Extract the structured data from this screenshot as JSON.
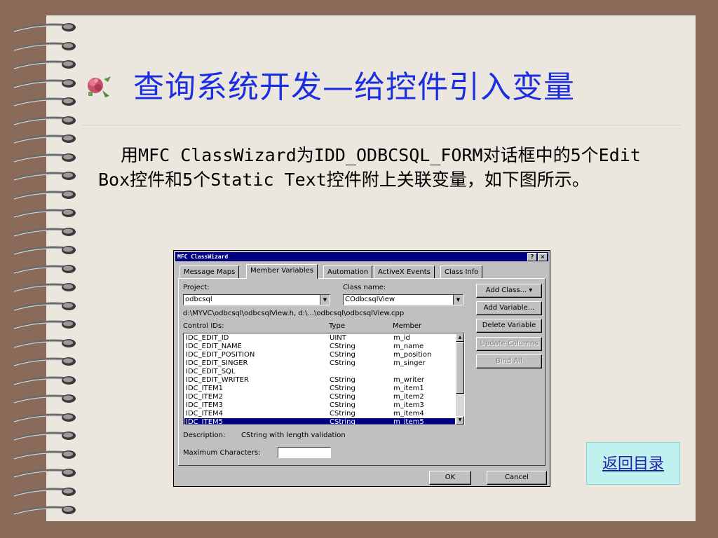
{
  "slide": {
    "title": "查询系统开发—给控件引入变量",
    "body_text": "用MFC ClassWizard为IDD_ODBCSQL_FORM对话框中的5个Edit Box控件和5个Static Text控件附上关联变量，如下图所示。",
    "nav_button_label": "返回目录",
    "colors": {
      "title": "#1c2fe0",
      "background": "#ece7de",
      "frame": "#8a6a58",
      "nav_button": "#bff2ee"
    }
  },
  "dialog": {
    "title": "MFC ClassWizard",
    "title_buttons": [
      "?",
      "×"
    ],
    "tabs": [
      "Message Maps",
      "Member Variables",
      "Automation",
      "ActiveX Events",
      "Class Info"
    ],
    "active_tab": "Member Variables",
    "project_label": "Project:",
    "project_value": "odbcsql",
    "class_name_label": "Class name:",
    "class_name_value": "COdbcsqlView",
    "file_path": "d:\\MYVC\\odbcsql\\odbcsqlView.h, d:\\...\\odbcsql\\odbcsqlView.cpp",
    "columns": {
      "control_ids": "Control IDs:",
      "type": "Type",
      "member": "Member"
    },
    "rows": [
      {
        "id": "IDC_EDIT_ID",
        "type": "UINT",
        "member": "m_id"
      },
      {
        "id": "IDC_EDIT_NAME",
        "type": "CString",
        "member": "m_name"
      },
      {
        "id": "IDC_EDIT_POSITION",
        "type": "CString",
        "member": "m_position"
      },
      {
        "id": "IDC_EDIT_SINGER",
        "type": "CString",
        "member": "m_singer"
      },
      {
        "id": "IDC_EDIT_SQL",
        "type": "",
        "member": ""
      },
      {
        "id": "IDC_EDIT_WRITER",
        "type": "CString",
        "member": "m_writer"
      },
      {
        "id": "IDC_ITEM1",
        "type": "CString",
        "member": "m_item1"
      },
      {
        "id": "IDC_ITEM2",
        "type": "CString",
        "member": "m_item2"
      },
      {
        "id": "IDC_ITEM3",
        "type": "CString",
        "member": "m_item3"
      },
      {
        "id": "IDC_ITEM4",
        "type": "CString",
        "member": "m_item4"
      },
      {
        "id": "IDC_ITEM5",
        "type": "CString",
        "member": "m_item5"
      }
    ],
    "selected_row": "IDC_ITEM5",
    "buttons": {
      "add_class": "Add Class...",
      "add_variable": "Add Variable...",
      "delete_variable": "Delete Variable",
      "update_columns": "Update Columns",
      "bind_all": "Bind All",
      "ok": "OK",
      "cancel": "Cancel"
    },
    "description_label": "Description:",
    "description_value": "CString with length validation",
    "max_chars_label": "Maximum Characters:",
    "max_chars_value": ""
  }
}
